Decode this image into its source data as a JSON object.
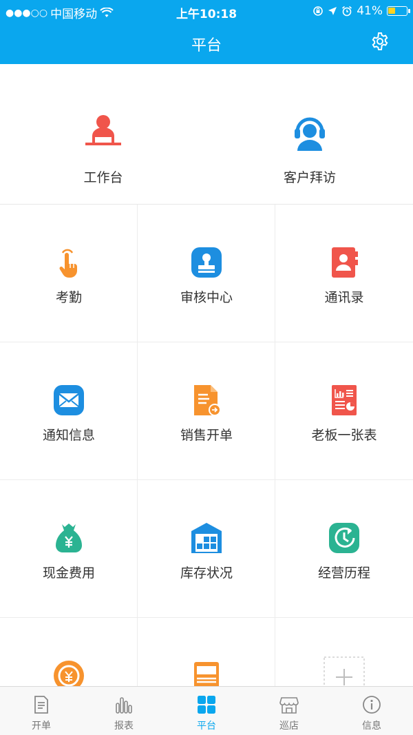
{
  "status_bar": {
    "signal": "●●●○○",
    "carrier": "中国移动",
    "time": "上午10:18",
    "battery": "41%",
    "battery_level": 0.41
  },
  "header": {
    "title": "平台"
  },
  "featured": [
    {
      "label": "工作台",
      "icon": "workstation-icon"
    },
    {
      "label": "客户拜访",
      "icon": "customer-service-icon"
    }
  ],
  "grid": [
    {
      "label": "考勤",
      "icon": "touch-hand-icon"
    },
    {
      "label": "审核中心",
      "icon": "stamp-icon"
    },
    {
      "label": "通讯录",
      "icon": "contact-book-icon"
    },
    {
      "label": "通知信息",
      "icon": "envelope-icon"
    },
    {
      "label": "销售开单",
      "icon": "sales-doc-icon"
    },
    {
      "label": "老板一张表",
      "icon": "report-sheet-icon"
    },
    {
      "label": "现金费用",
      "icon": "money-bag-icon"
    },
    {
      "label": "库存状况",
      "icon": "warehouse-icon"
    },
    {
      "label": "经营历程",
      "icon": "history-clock-icon"
    }
  ],
  "tabs": [
    {
      "label": "开单",
      "icon": "document-icon"
    },
    {
      "label": "报表",
      "icon": "bar-chart-icon"
    },
    {
      "label": "平台",
      "icon": "grid-icon"
    },
    {
      "label": "巡店",
      "icon": "shop-icon"
    },
    {
      "label": "信息",
      "icon": "info-icon"
    }
  ],
  "colors": {
    "primary": "#0aa7ee",
    "red": "#f0554b",
    "orange": "#f7932e",
    "teal": "#2bb392",
    "blue": "#1d8ee0"
  }
}
